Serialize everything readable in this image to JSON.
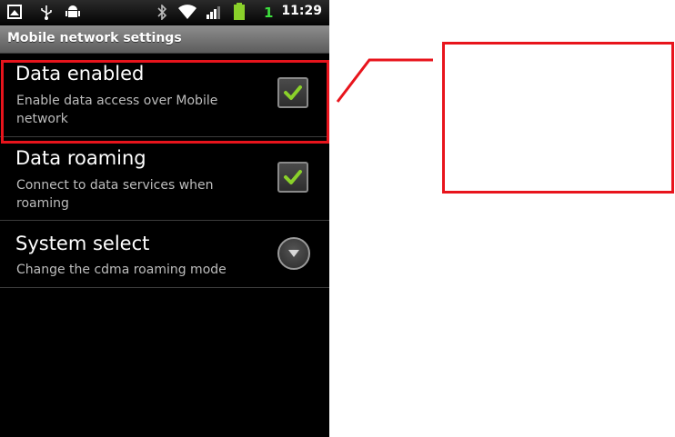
{
  "status_bar": {
    "time": "11:29",
    "network_badge": "1",
    "icons": [
      "gallery-icon",
      "usb-icon",
      "android-debug-icon",
      "bluetooth-icon",
      "wifi-icon",
      "signal-icon",
      "battery-icon"
    ]
  },
  "title_bar": {
    "title": "Mobile network settings"
  },
  "preferences": [
    {
      "title": "Data enabled",
      "summary": "Enable data access over Mobile network",
      "control": "checkbox",
      "checked": true
    },
    {
      "title": "Data roaming",
      "summary": "Connect to data services when roaming",
      "control": "checkbox",
      "checked": true
    },
    {
      "title": "System select",
      "summary": "Change the cdma roaming mode",
      "control": "dropdown"
    }
  ],
  "colors": {
    "annotation_red": "#e8141c",
    "check_green": "#8ad12a",
    "network_badge_green": "#3ee03e"
  }
}
